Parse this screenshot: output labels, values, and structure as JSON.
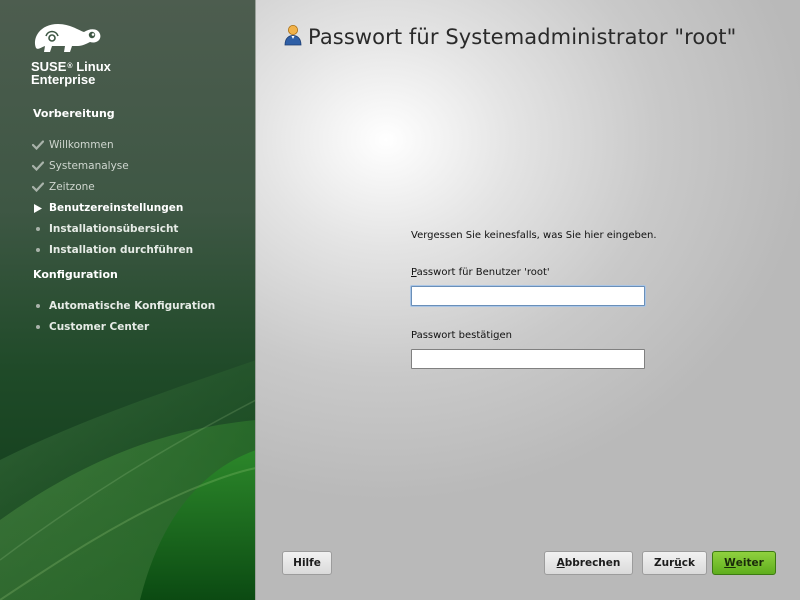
{
  "brand": {
    "name": "SUSE",
    "registered": "®",
    "product": "Linux",
    "product_line2": "Enterprise"
  },
  "sidebar": {
    "sections": [
      {
        "title": "Vorbereitung"
      },
      {
        "title": "Konfiguration"
      }
    ],
    "steps": [
      {
        "label": "Willkommen",
        "state": "done",
        "icon": "check-icon"
      },
      {
        "label": "Systemanalyse",
        "state": "done",
        "icon": "check-icon"
      },
      {
        "label": "Zeitzone",
        "state": "done",
        "icon": "check-icon"
      },
      {
        "label": "Benutzereinstellungen",
        "state": "current",
        "icon": "arrow-right-icon"
      },
      {
        "label": "Installationsübersicht",
        "state": "todo",
        "icon": "bullet-icon"
      },
      {
        "label": "Installation durchführen",
        "state": "todo",
        "icon": "bullet-icon"
      },
      {
        "label": "Automatische Konfiguration",
        "state": "todo",
        "icon": "bullet-icon"
      },
      {
        "label": "Customer Center",
        "state": "todo",
        "icon": "bullet-icon"
      }
    ]
  },
  "main": {
    "title": "Passwort für Systemadministrator \"root\"",
    "title_icon": "user-icon",
    "hint": "Vergessen Sie keinesfalls, was Sie hier eingeben.",
    "password": {
      "label_prefix": "",
      "label_mnemonic": "P",
      "label_rest": "asswort für Benutzer 'root'",
      "value": ""
    },
    "confirm": {
      "label_prefix": "Passwort bestäti",
      "label_mnemonic": "g",
      "label_rest": "en",
      "value": ""
    }
  },
  "buttons": {
    "help": {
      "mnemonic": "",
      "rest": "Hilfe"
    },
    "abort": {
      "mnemonic": "A",
      "rest": "bbrechen"
    },
    "back": {
      "prefix": "Zur",
      "mnemonic": "ü",
      "rest": "ck"
    },
    "next": {
      "mnemonic": "W",
      "rest": "eiter"
    }
  },
  "colors": {
    "sidebar_green": "#1f4a28",
    "primary_button": "#6cbf24",
    "focus_border": "#6a8fb8"
  }
}
